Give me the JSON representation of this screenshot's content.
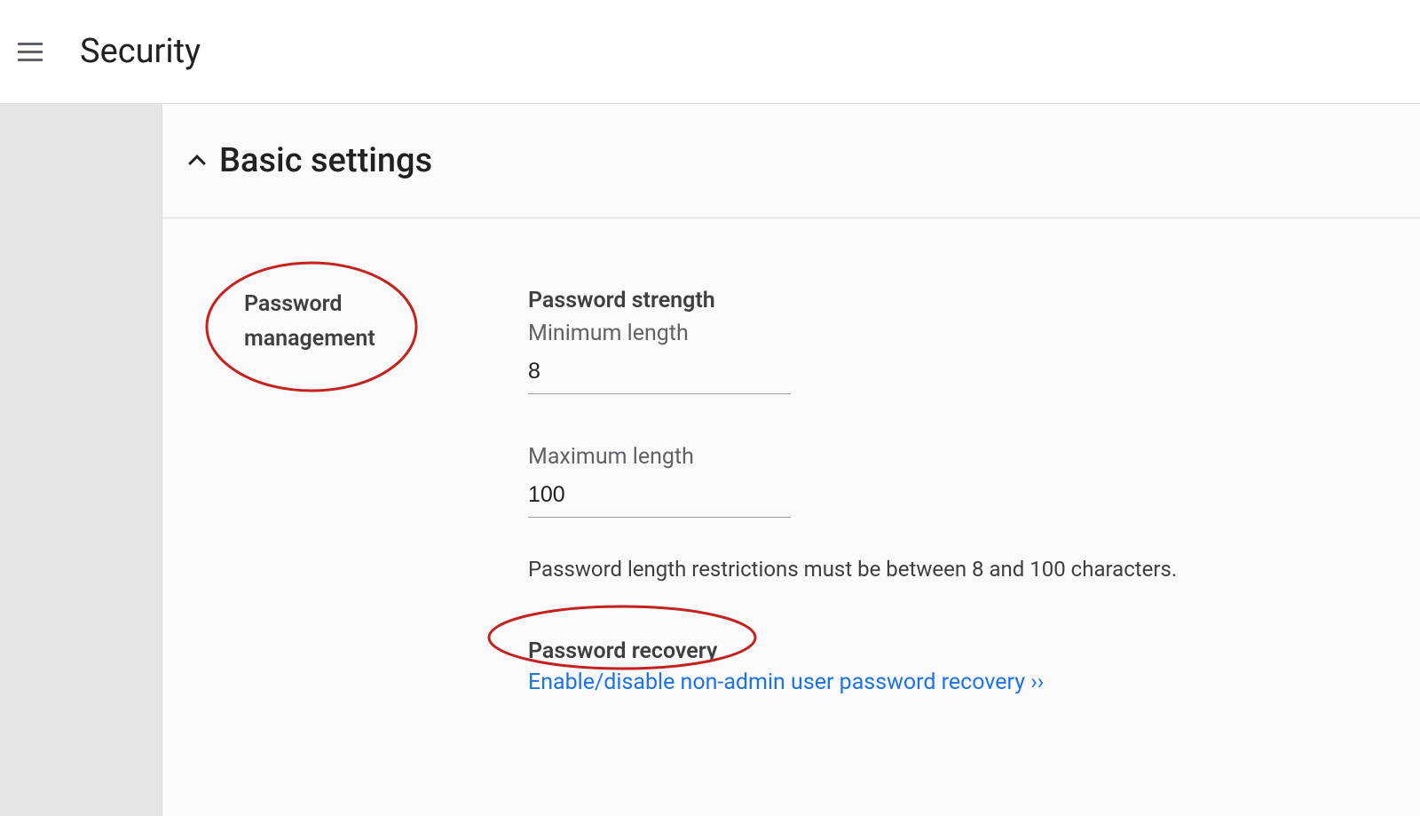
{
  "header": {
    "title": "Security"
  },
  "section": {
    "title": "Basic settings"
  },
  "password_management": {
    "label_line1": "Password",
    "label_line2": "management",
    "strength_title": "Password strength",
    "min_label": "Minimum length",
    "min_value": "8",
    "max_label": "Maximum length",
    "max_value": "100",
    "helper": "Password length restrictions must be between 8 and 100 characters.",
    "recovery_title": "Password recovery",
    "recovery_link": "Enable/disable non-admin user password recovery ››"
  }
}
